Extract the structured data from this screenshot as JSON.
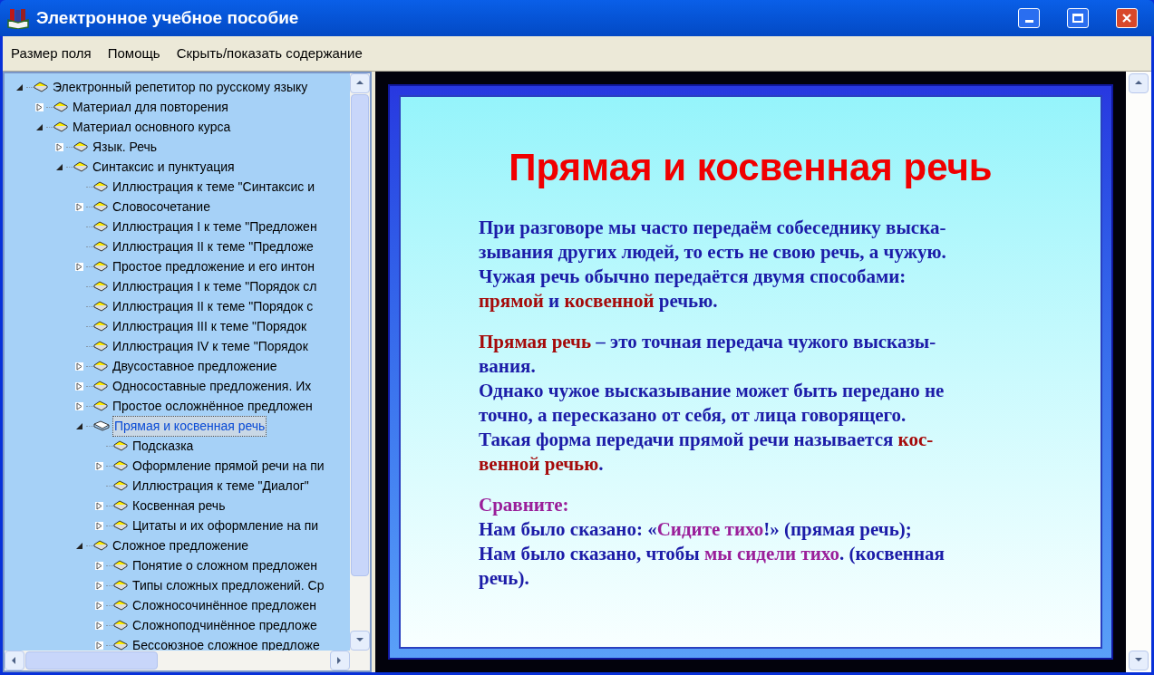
{
  "window": {
    "title": "Электронное учебное пособие"
  },
  "menu": [
    "Размер поля",
    "Помощь",
    "Скрыть/показать содержание"
  ],
  "tree": [
    {
      "label": "Электронный репетитор по русскому языку",
      "kind": "folder",
      "expanded": true,
      "selected": false,
      "children": [
        {
          "label": "Материал для повторения",
          "kind": "folder",
          "expanded": false,
          "selected": false
        },
        {
          "label": "Материал основного курса",
          "kind": "folder",
          "expanded": true,
          "selected": false,
          "children": [
            {
              "label": "Язык. Речь",
              "kind": "folder",
              "expanded": false,
              "selected": false
            },
            {
              "label": "Синтаксис и пунктуация",
              "kind": "folder",
              "expanded": true,
              "selected": false,
              "children": [
                {
                  "label": "Иллюстрация к теме \"Синтаксис и",
                  "kind": "leaf",
                  "selected": false
                },
                {
                  "label": "Словосочетание",
                  "kind": "folder",
                  "expanded": false,
                  "selected": false
                },
                {
                  "label": "Иллюстрация I к теме \"Предложен",
                  "kind": "leaf",
                  "selected": false
                },
                {
                  "label": "Иллюстрация II к теме \"Предложе",
                  "kind": "leaf",
                  "selected": false
                },
                {
                  "label": "Простое предложение и его интон",
                  "kind": "folder",
                  "expanded": false,
                  "selected": false
                },
                {
                  "label": "Иллюстрация I к теме \"Порядок сл",
                  "kind": "leaf",
                  "selected": false
                },
                {
                  "label": "Иллюстрация II к теме \"Порядок с",
                  "kind": "leaf",
                  "selected": false
                },
                {
                  "label": "Иллюстрация III к теме \"Порядок",
                  "kind": "leaf",
                  "selected": false
                },
                {
                  "label": "Иллюстрация IV к теме \"Порядок",
                  "kind": "leaf",
                  "selected": false
                },
                {
                  "label": "Двусоставное предложение",
                  "kind": "folder",
                  "expanded": false,
                  "selected": false
                },
                {
                  "label": "Односоставные предложения. Их",
                  "kind": "folder",
                  "expanded": false,
                  "selected": false
                },
                {
                  "label": "Простое осложнённое предложен",
                  "kind": "folder",
                  "expanded": false,
                  "selected": false
                },
                {
                  "label": "Прямая и косвенная речь",
                  "kind": "folder",
                  "expanded": true,
                  "selected": true,
                  "children": [
                    {
                      "label": "Подсказка",
                      "kind": "leaf",
                      "selected": false
                    },
                    {
                      "label": "Оформление прямой речи на пи",
                      "kind": "folder",
                      "expanded": false,
                      "selected": false
                    },
                    {
                      "label": "Иллюстрация к теме \"Диалог\"",
                      "kind": "leaf",
                      "selected": false
                    },
                    {
                      "label": "Косвенная речь",
                      "kind": "folder",
                      "expanded": false,
                      "selected": false
                    },
                    {
                      "label": "Цитаты и их оформление на пи",
                      "kind": "folder",
                      "expanded": false,
                      "selected": false
                    }
                  ]
                },
                {
                  "label": "Сложное предложение",
                  "kind": "folder",
                  "expanded": true,
                  "selected": false,
                  "children": [
                    {
                      "label": "Понятие о сложном предложен",
                      "kind": "folder",
                      "expanded": false,
                      "selected": false
                    },
                    {
                      "label": "Типы сложных предложений. Ср",
                      "kind": "folder",
                      "expanded": false,
                      "selected": false
                    },
                    {
                      "label": "Сложносочинённое предложен",
                      "kind": "folder",
                      "expanded": false,
                      "selected": false
                    },
                    {
                      "label": "Сложноподчинённое предложе",
                      "kind": "folder",
                      "expanded": false,
                      "selected": false
                    },
                    {
                      "label": "Бессоюзное сложное предложе",
                      "kind": "folder",
                      "expanded": false,
                      "selected": false
                    }
                  ]
                }
              ]
            }
          ]
        }
      ]
    }
  ],
  "slide": {
    "title": "Прямая и косвенная речь",
    "paragraphs": [
      [
        [
          {
            "kind": "text",
            "text": "При разговоре мы часто передаём собеседнику выска-"
          }
        ],
        [
          {
            "kind": "text",
            "text": "зывания других людей, то есть не свою речь, а чужую."
          }
        ],
        [
          {
            "kind": "text",
            "text": "Чужая речь обычно передаётся двумя способами:"
          }
        ],
        [
          {
            "kind": "term",
            "text": "прямой"
          },
          {
            "kind": "text",
            "text": " и "
          },
          {
            "kind": "term",
            "text": "косвенной"
          },
          {
            "kind": "text",
            "text": " речью."
          }
        ]
      ],
      [
        [
          {
            "kind": "term",
            "text": "Прямая речь"
          },
          {
            "kind": "text",
            "text": " – это точная передача чужого высказы-"
          }
        ],
        [
          {
            "kind": "text",
            "text": "вания."
          }
        ],
        [
          {
            "kind": "text",
            "text": "Однако чужое высказывание может быть передано не"
          }
        ],
        [
          {
            "kind": "text",
            "text": "точно, а пересказано от себя, от лица говорящего."
          }
        ],
        [
          {
            "kind": "text",
            "text": "Такая форма передачи прямой речи называется "
          },
          {
            "kind": "term",
            "text": "кос-"
          }
        ],
        [
          {
            "kind": "term",
            "text": "венной речью"
          },
          {
            "kind": "text",
            "text": "."
          }
        ]
      ],
      [
        [
          {
            "kind": "example",
            "text": "Сравните:"
          }
        ],
        [
          {
            "kind": "text",
            "text": "Нам было сказано: «"
          },
          {
            "kind": "example",
            "text": "Сидите тихо"
          },
          {
            "kind": "text",
            "text": "!» (прямая речь);"
          }
        ],
        [
          {
            "kind": "text",
            "text": "Нам было сказано, чтобы "
          },
          {
            "kind": "example",
            "text": "мы сидели тихо"
          },
          {
            "kind": "text",
            "text": ". (косвенная"
          }
        ],
        [
          {
            "kind": "text",
            "text": "речь)."
          }
        ]
      ]
    ]
  }
}
